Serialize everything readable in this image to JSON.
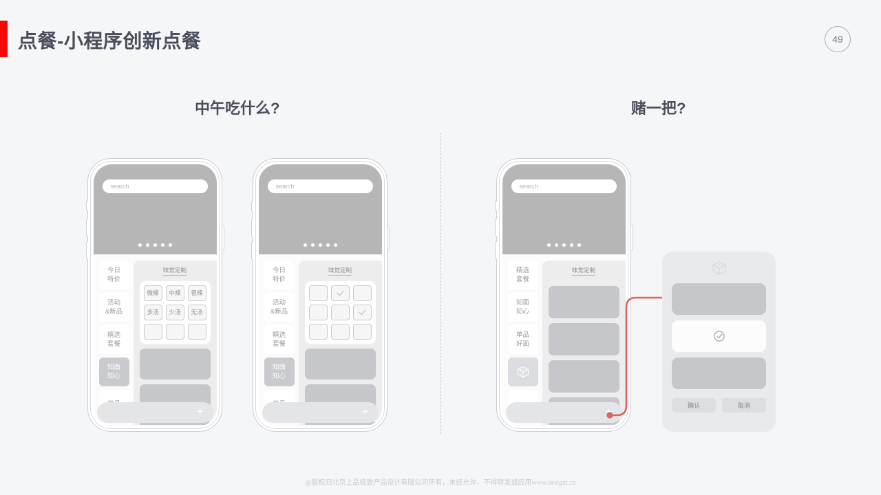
{
  "header": {
    "title": "点餐-小程序创新点餐",
    "page_number": "49",
    "accent_color": "#f50a0a",
    "title_color": "#4a4e5c"
  },
  "sections": {
    "left_heading": "中午吃什么?",
    "right_heading": "赌一把?"
  },
  "phones": {
    "phone1": {
      "search_placeholder": "search",
      "carousel_dots": 5,
      "content_title": "味觉定制",
      "categories": [
        {
          "label_line1": "今日",
          "label_line2": "特价",
          "state": "normal"
        },
        {
          "label_line1": "活动",
          "label_line2": "&新品",
          "state": "normal"
        },
        {
          "label_line1": "精选",
          "label_line2": "套餐",
          "state": "normal"
        },
        {
          "label_line1": "知面",
          "label_line2": "知心",
          "state": "active"
        },
        {
          "label_line1": "单品",
          "label_line2": "",
          "state": "normal"
        }
      ],
      "chip_rows": [
        [
          "微辣",
          "中辣",
          "很辣"
        ],
        [
          "多汤",
          "少汤",
          "无汤"
        ],
        [
          "",
          "",
          ""
        ]
      ],
      "tabbar_add_label": "+"
    },
    "phone2": {
      "search_placeholder": "search",
      "carousel_dots": 5,
      "content_title": "味觉定制",
      "categories": [
        {
          "label_line1": "今日",
          "label_line2": "特价",
          "state": "normal"
        },
        {
          "label_line1": "活动",
          "label_line2": "&新品",
          "state": "normal"
        },
        {
          "label_line1": "精选",
          "label_line2": "套餐",
          "state": "normal"
        },
        {
          "label_line1": "知面",
          "label_line2": "知心",
          "state": "active"
        },
        {
          "label_line1": "单品",
          "label_line2": "",
          "state": "normal"
        }
      ],
      "chip_checked": [
        [
          false,
          true,
          false
        ],
        [
          false,
          false,
          true
        ],
        [
          false,
          false,
          false
        ]
      ],
      "tabbar_add_label": "+"
    },
    "phone3": {
      "search_placeholder": "search",
      "carousel_dots": 5,
      "content_title": "味觉定制",
      "categories": [
        {
          "label_line1": "精选",
          "label_line2": "套餐",
          "state": "normal"
        },
        {
          "label_line1": "知面",
          "label_line2": "知心",
          "state": "normal"
        },
        {
          "label_line1": "单品",
          "label_line2": "好面",
          "state": "normal"
        },
        {
          "label_line1": "",
          "label_line2": "",
          "state": "dice"
        },
        {
          "label_line1": "",
          "label_line2": "",
          "state": "normal"
        }
      ],
      "tabbar_add_label": "+"
    }
  },
  "popup": {
    "icon": "dice-icon",
    "options": [
      {
        "selected": false
      },
      {
        "selected": true
      },
      {
        "selected": false
      }
    ],
    "confirm_label": "确认",
    "cancel_label": "取消"
  },
  "connector": {
    "color": "#d9655f"
  },
  "footer": {
    "text": "@版权归北京上品极致产品设计有限公司所有，未经允许，不得转发或应用www.designt.cn"
  }
}
